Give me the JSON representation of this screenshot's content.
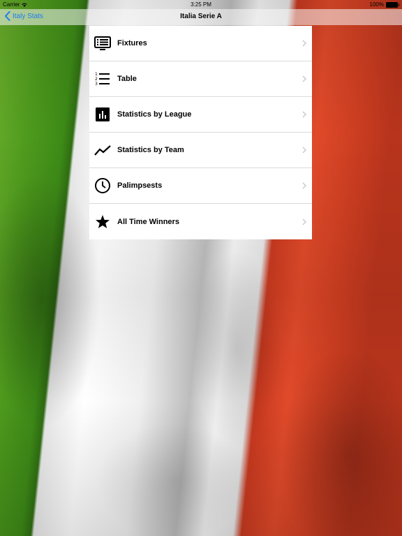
{
  "status_bar": {
    "carrier": "Carrier",
    "time": "3:25 PM",
    "battery": "100%"
  },
  "nav": {
    "back_label": "Italy Stats",
    "title": "Italia Serie A"
  },
  "menu": {
    "items": [
      {
        "label": "Fixtures",
        "icon": "fixtures-list-icon"
      },
      {
        "label": "Table",
        "icon": "numbered-list-icon"
      },
      {
        "label": "Statistics by League",
        "icon": "bar-chart-icon"
      },
      {
        "label": "Statistics by Team",
        "icon": "trend-line-icon"
      },
      {
        "label": "Palimpsests",
        "icon": "clock-icon"
      },
      {
        "label": "All Time Winners",
        "icon": "star-icon"
      }
    ]
  },
  "colors": {
    "accent": "#1a7cf5",
    "flag_green": "#3d8a17",
    "flag_white": "#ffffff",
    "flag_red": "#e04a2a"
  }
}
